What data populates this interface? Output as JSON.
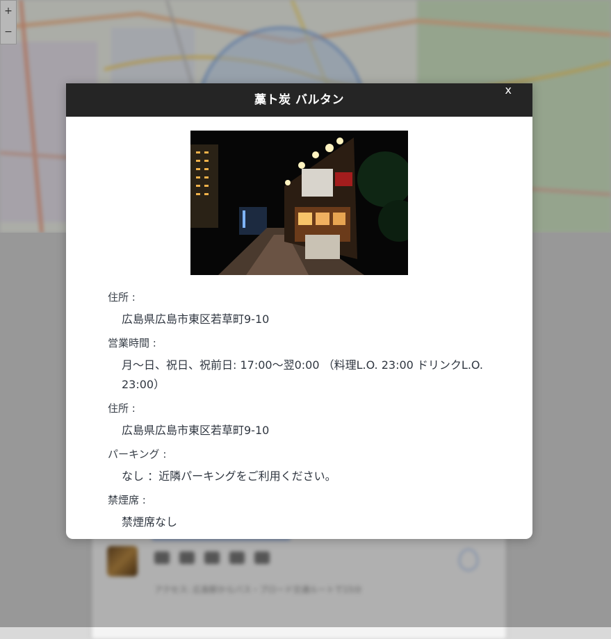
{
  "modal": {
    "title": "藁ト炭 バルタン",
    "close_label": "x",
    "photo_icon": "store-photo",
    "sections": [
      {
        "label": "住所 :",
        "value": "広島県広島市東区若草町9-10"
      },
      {
        "label": "営業時間 :",
        "value": "月～日、祝日、祝前日: 17:00～翌0:00 （料理L.O. 23:00 ドリンクL.O. 23:00）"
      },
      {
        "label": "住所 :",
        "value": "広島県広島市東区若草町9-10"
      },
      {
        "label": "パーキング :",
        "value": "なし ：近隣パーキングをご利用ください。"
      },
      {
        "label": "禁煙席 :",
        "value": "禁煙席なし"
      }
    ]
  },
  "background": {
    "zoom_in": "+",
    "zoom_out": "−",
    "card_text": "アクセス: 広島駅からバス・ブロード交通ルートで15分"
  },
  "colors": {
    "header_bg": "#252525",
    "overlay": "rgba(0,0,0,0.28)",
    "accent_blue": "#9fbbe8"
  }
}
